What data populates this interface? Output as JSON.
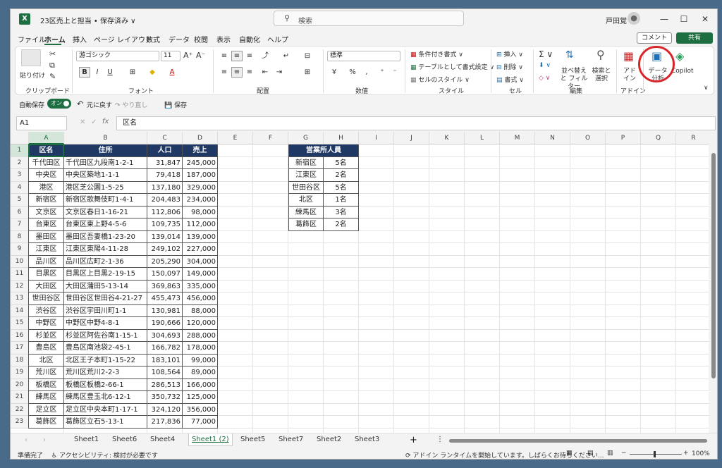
{
  "titlebar": {
    "app_icon": "X",
    "doc_title": "23区売上と担当 • 保存済み ∨",
    "search_placeholder": "検索",
    "user_name": "戸田覚",
    "minimize": "—",
    "maximize": "☐",
    "close": "✕"
  },
  "menu": [
    "ファイル",
    "ホーム",
    "挿入",
    "ページ レイアウト",
    "数式",
    "データ",
    "校閲",
    "表示",
    "自動化",
    "ヘルプ"
  ],
  "comment_label": "コメント",
  "share_label": "共有",
  "ribbon": {
    "paste": "貼り付け",
    "clipboard": "クリップボード",
    "font_name": "游ゴシック",
    "font_size": "11",
    "font_group": "フォント",
    "bold": "B",
    "italic": "I",
    "underline": "U",
    "align_group": "配置",
    "number_format": "標準",
    "number_group": "数値",
    "cond_format": "条件付き書式 ∨",
    "table_format": "テーブルとして書式設定 ∨",
    "cell_style": "セルのスタイル ∨",
    "style_group": "スタイル",
    "insert": "挿入",
    "delete": "削除",
    "format": "書式",
    "cell_group": "セル",
    "sum": "Σ",
    "sort_filter": "並べ替えと フィルター",
    "find_select": "検索と 選択",
    "edit_group": "編集",
    "addin": "アド イン",
    "addin_group": "アドイン",
    "data_analysis": "データ 分析",
    "copilot": "Copilot"
  },
  "qa": {
    "autosave": "自動保存",
    "toggle": "オン",
    "undo": "元に戻す",
    "redo": "やり直し",
    "save": "保存"
  },
  "formula": {
    "namebox": "A1",
    "content": "区名"
  },
  "columns": [
    "A",
    "B",
    "C",
    "D",
    "E",
    "F",
    "G",
    "H",
    "I",
    "J",
    "K",
    "L",
    "M",
    "N",
    "O",
    "P",
    "Q",
    "R"
  ],
  "rows": [
    "1",
    "2",
    "3",
    "4",
    "5",
    "6",
    "7",
    "8",
    "9",
    "10",
    "11",
    "12",
    "13",
    "14",
    "15",
    "16",
    "17",
    "18",
    "19",
    "20",
    "21",
    "22",
    "23"
  ],
  "table_main": {
    "headers": [
      "区名",
      "住所",
      "人口",
      "売上"
    ],
    "rows": [
      [
        "千代田区",
        "千代田区九段南1-2-1",
        "31,847",
        "245,000"
      ],
      [
        "中央区",
        "中央区築地1-1-1",
        "79,418",
        "187,000"
      ],
      [
        "港区",
        "港区芝公園1-5-25",
        "137,180",
        "329,000"
      ],
      [
        "新宿区",
        "新宿区歌舞伎町1-4-1",
        "204,483",
        "234,000"
      ],
      [
        "文京区",
        "文京区春日1-16-21",
        "112,806",
        "98,000"
      ],
      [
        "台東区",
        "台東区東上野4-5-6",
        "109,735",
        "112,000"
      ],
      [
        "墨田区",
        "墨田区吾妻橋1-23-20",
        "139,014",
        "139,000"
      ],
      [
        "江東区",
        "江東区東陽4-11-28",
        "249,102",
        "227,000"
      ],
      [
        "品川区",
        "品川区広町2-1-36",
        "205,290",
        "304,000"
      ],
      [
        "目黒区",
        "目黒区上目黒2-19-15",
        "150,097",
        "149,000"
      ],
      [
        "大田区",
        "大田区蒲田5-13-14",
        "369,863",
        "335,000"
      ],
      [
        "世田谷区",
        "世田谷区世田谷4-21-27",
        "455,473",
        "456,000"
      ],
      [
        "渋谷区",
        "渋谷区宇田川町1-1",
        "130,981",
        "88,000"
      ],
      [
        "中野区",
        "中野区中野4-8-1",
        "190,666",
        "120,000"
      ],
      [
        "杉並区",
        "杉並区阿佐谷南1-15-1",
        "304,693",
        "288,000"
      ],
      [
        "豊島区",
        "豊島区南池袋2-45-1",
        "166,782",
        "178,000"
      ],
      [
        "北区",
        "北区王子本町1-15-22",
        "183,101",
        "99,000"
      ],
      [
        "荒川区",
        "荒川区荒川2-2-3",
        "108,564",
        "89,000"
      ],
      [
        "板橋区",
        "板橋区板橋2-66-1",
        "286,513",
        "166,000"
      ],
      [
        "練馬区",
        "練馬区豊玉北6-12-1",
        "350,732",
        "125,000"
      ],
      [
        "足立区",
        "足立区中央本町1-17-1",
        "324,120",
        "356,000"
      ],
      [
        "葛飾区",
        "葛飾区立石5-13-1",
        "217,836",
        "77,000"
      ]
    ]
  },
  "table_staff": {
    "header": "営業所人員",
    "rows": [
      [
        "新宿区",
        "5名"
      ],
      [
        "江東区",
        "2名"
      ],
      [
        "世田谷区",
        "5名"
      ],
      [
        "北区",
        "1名"
      ],
      [
        "練馬区",
        "3名"
      ],
      [
        "葛飾区",
        "2名"
      ]
    ]
  },
  "sheets": [
    "Sheet1",
    "Sheet6",
    "Sheet4",
    "Sheet1 (2)",
    "Sheet5",
    "Sheet7",
    "Sheet2",
    "Sheet3"
  ],
  "active_sheet": "Sheet1 (2)",
  "status": {
    "ready": "準備完了",
    "accessibility": "アクセシビリティ: 検討が必要です",
    "addin_msg": "アドイン ランタイムを開始しています。しばらくお待ちください...",
    "zoom": "100%"
  }
}
